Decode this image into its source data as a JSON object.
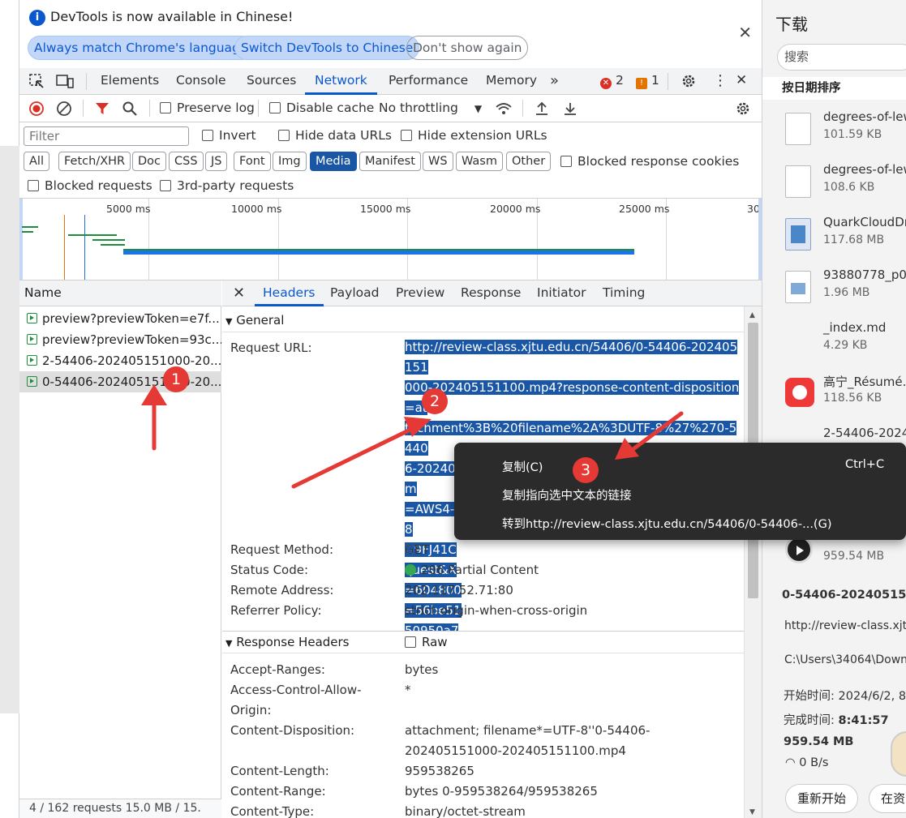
{
  "infobar": {
    "message": "DevTools is now available in Chinese!",
    "btn_match": "Always match Chrome's language",
    "btn_switch": "Switch DevTools to Chinese",
    "btn_dismiss": "Don't show again"
  },
  "panels": [
    "Elements",
    "Console",
    "Sources",
    "Network",
    "Performance",
    "Memory"
  ],
  "active_panel": "Network",
  "more": "»",
  "errors_count": "2",
  "warnings_count": "1",
  "toolbar": {
    "preserve_log": "Preserve log",
    "disable_cache": "Disable cache",
    "throttling": "No throttling"
  },
  "filter": {
    "placeholder": "Filter",
    "invert": "Invert",
    "hide_data_urls": "Hide data URLs",
    "hide_ext_urls": "Hide extension URLs",
    "blocked_cookies": "Blocked response cookies",
    "blocked_requests": "Blocked requests",
    "third_party": "3rd-party requests"
  },
  "type_filters": [
    "All",
    "Fetch/XHR",
    "Doc",
    "CSS",
    "JS",
    "Font",
    "Img",
    "Media",
    "Manifest",
    "WS",
    "Wasm",
    "Other"
  ],
  "selected_type": "Media",
  "timeline_labels": [
    "5000 ms",
    "10000 ms",
    "15000 ms",
    "20000 ms",
    "25000 ms",
    "30"
  ],
  "list": {
    "header": "Name",
    "rows": [
      "preview?previewToken=e7f...",
      "preview?previewToken=93c...",
      "2-54406-202405151000-20...",
      "0-54406-202405151000-20..."
    ],
    "status": "4 / 162 requests   15.0 MB / 15."
  },
  "detail_tabs": [
    "Headers",
    "Payload",
    "Preview",
    "Response",
    "Initiator",
    "Timing"
  ],
  "active_detail_tab": "Headers",
  "general": {
    "title": "General",
    "url_label": "Request URL:",
    "url_lines": [
      "http://review-class.xjtu.edu.cn/54406/0-54406-202405151",
      "000-202405151100.mp4?response-content-disposition=at",
      "tachment%3B%20filename%2A%3DUTF-8%27%270-5440",
      "6-202405151000-202405151100.mp4&X-Amz-Algorithm",
      "=AWS4-HMAC-SHA256&X-Amz-Credential=BRGJIECAY58",
      "G9FJ41C",
      "quest&X",
      "=604800",
      "=56be51",
      "50950a7"
    ],
    "method_label": "Request Method:",
    "method": "GET",
    "status_label": "Status Code:",
    "status": "206 Partial Content",
    "remote_label": "Remote Address:",
    "remote": "202.117.52.71:80",
    "referrer_label": "Referrer Policy:",
    "referrer": "strict-origin-when-cross-origin"
  },
  "response_headers": {
    "title": "Response Headers",
    "raw": "Raw",
    "accept_ranges_label": "Accept-Ranges:",
    "accept_ranges": "bytes",
    "acao_label_1": "Access-Control-Allow-",
    "acao_label_2": "Origin:",
    "acao": "*",
    "cd_label": "Content-Disposition:",
    "cd_1": "attachment; filename*=UTF-8''0-54406-",
    "cd_2": "202405151000-202405151100.mp4",
    "cl_label": "Content-Length:",
    "cl": "959538265",
    "cr_label": "Content-Range:",
    "cr": "bytes 0-959538264/959538265",
    "ct_label": "Content-Type:",
    "ct": "binary/octet-stream"
  },
  "context_menu": {
    "copy": "复制(C)",
    "copy_shortcut": "Ctrl+C",
    "copy_link": "复制指向选中文本的链接",
    "goto": "转到http://review-class.xjtu.edu.cn/54406/0-54406-...(G)"
  },
  "downloads": {
    "title": "下载",
    "search_placeholder": "搜索",
    "sort": "按日期排序",
    "items": [
      {
        "name": "degrees-of-lew",
        "size": "101.59 KB"
      },
      {
        "name": "degrees-of-lew",
        "size": "108.6 KB"
      },
      {
        "name": "QuarkCloudDr",
        "size": "117.68 MB"
      },
      {
        "name": "93880778_p0.p",
        "size": "1.96 MB"
      },
      {
        "name": "_index.md",
        "size": "4.29 KB"
      },
      {
        "name": "高宁_Résumé.p",
        "size": "118.56 KB"
      },
      {
        "name": "2-54406-20240",
        "size": ""
      },
      {
        "name": "",
        "size": "959.54 MB"
      }
    ],
    "detail_name": "0-54406-202405151",
    "detail_url": "http://review-class.xjt",
    "detail_path": "C:\\Users\\34064\\Down",
    "start_time": "开始时间:  2024/6/2, 8",
    "finish_time_label": "完成时间:",
    "finish_time": "8:41:57",
    "total_size": "959.54 MB",
    "speed": "0 B/s",
    "btn_restart": "重新开始",
    "btn_other": "在资"
  },
  "annotations": [
    "1",
    "2",
    "3"
  ],
  "colors": {
    "accent": "#0b57d0",
    "selection": "#1a56a6",
    "arrow": "#e53935",
    "status_ok": "#34a853"
  }
}
